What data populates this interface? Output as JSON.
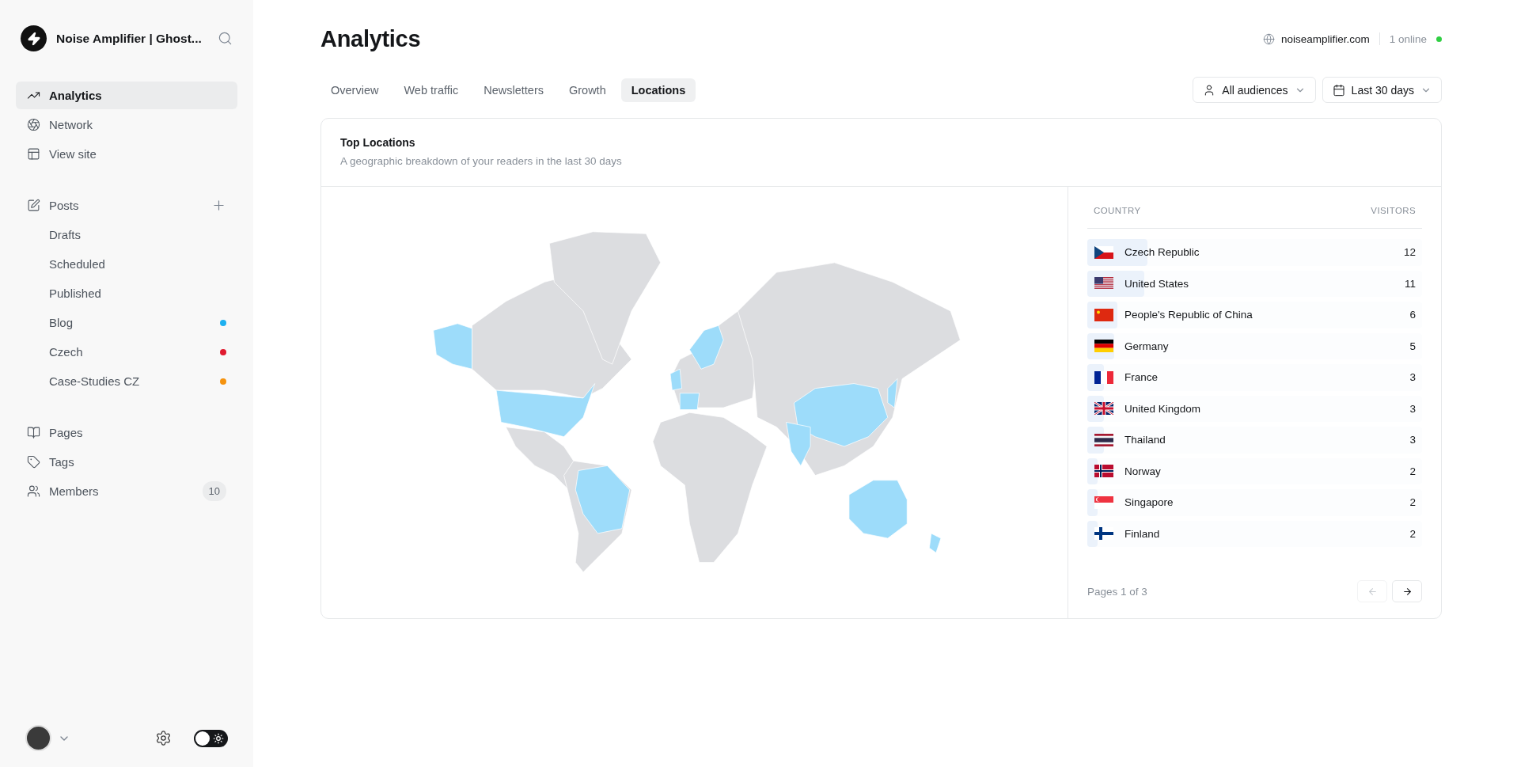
{
  "sidebar": {
    "site_title": "Noise Amplifier | Ghost...",
    "primary": [
      {
        "label": "Analytics",
        "selected": true
      },
      {
        "label": "Network",
        "selected": false
      },
      {
        "label": "View site",
        "selected": false
      }
    ],
    "posts": {
      "label": "Posts",
      "children": [
        {
          "label": "Drafts",
          "selected": false
        },
        {
          "label": "Scheduled",
          "selected": false
        },
        {
          "label": "Published",
          "selected": false
        },
        {
          "label": "Blog",
          "selected": false,
          "color": "#1eb0f0"
        },
        {
          "label": "Czech",
          "selected": false,
          "color": "#e01b2f"
        },
        {
          "label": "Case-Studies CZ",
          "selected": false,
          "color": "#f5930f"
        }
      ]
    },
    "secondary": [
      {
        "label": "Pages",
        "selected": false
      },
      {
        "label": "Tags",
        "selected": false
      },
      {
        "label": "Members",
        "selected": false,
        "count": "10"
      }
    ],
    "theme_toggle": {
      "on": false
    }
  },
  "header": {
    "title": "Analytics",
    "site": "noiseamplifier.com",
    "online": "1 online"
  },
  "tabs": [
    {
      "label": "Overview",
      "selected": false
    },
    {
      "label": "Web traffic",
      "selected": false
    },
    {
      "label": "Newsletters",
      "selected": false
    },
    {
      "label": "Growth",
      "selected": false
    },
    {
      "label": "Locations",
      "selected": true
    }
  ],
  "filters": [
    {
      "label": "All audiences"
    },
    {
      "label": "Last 30 days"
    }
  ],
  "card": {
    "title": "Top Locations",
    "subtitle": "A geographic breakdown of your readers in the last 30 days",
    "table": {
      "columns": [
        "COUNTRY",
        "VISITORS"
      ],
      "rows": [
        {
          "country": "Czech Republic",
          "visitors": "12",
          "level": 0.18
        },
        {
          "country": "United States",
          "visitors": "11",
          "level": 0.17
        },
        {
          "country": "People's Republic of China",
          "visitors": "6",
          "level": 0.09
        },
        {
          "country": "Germany",
          "visitors": "5",
          "level": 0.08
        },
        {
          "country": "France",
          "visitors": "3",
          "level": 0.05
        },
        {
          "country": "United Kingdom",
          "visitors": "3",
          "level": 0.05
        },
        {
          "country": "Thailand",
          "visitors": "3",
          "level": 0.05
        },
        {
          "country": "Norway",
          "visitors": "2",
          "level": 0.03
        },
        {
          "country": "Singapore",
          "visitors": "2",
          "level": 0.03
        },
        {
          "country": "Finland",
          "visitors": "2",
          "level": 0.03
        }
      ]
    },
    "pagination": {
      "label": "Pages 1 of 3",
      "prev_disabled": true,
      "next_disabled": false
    }
  }
}
